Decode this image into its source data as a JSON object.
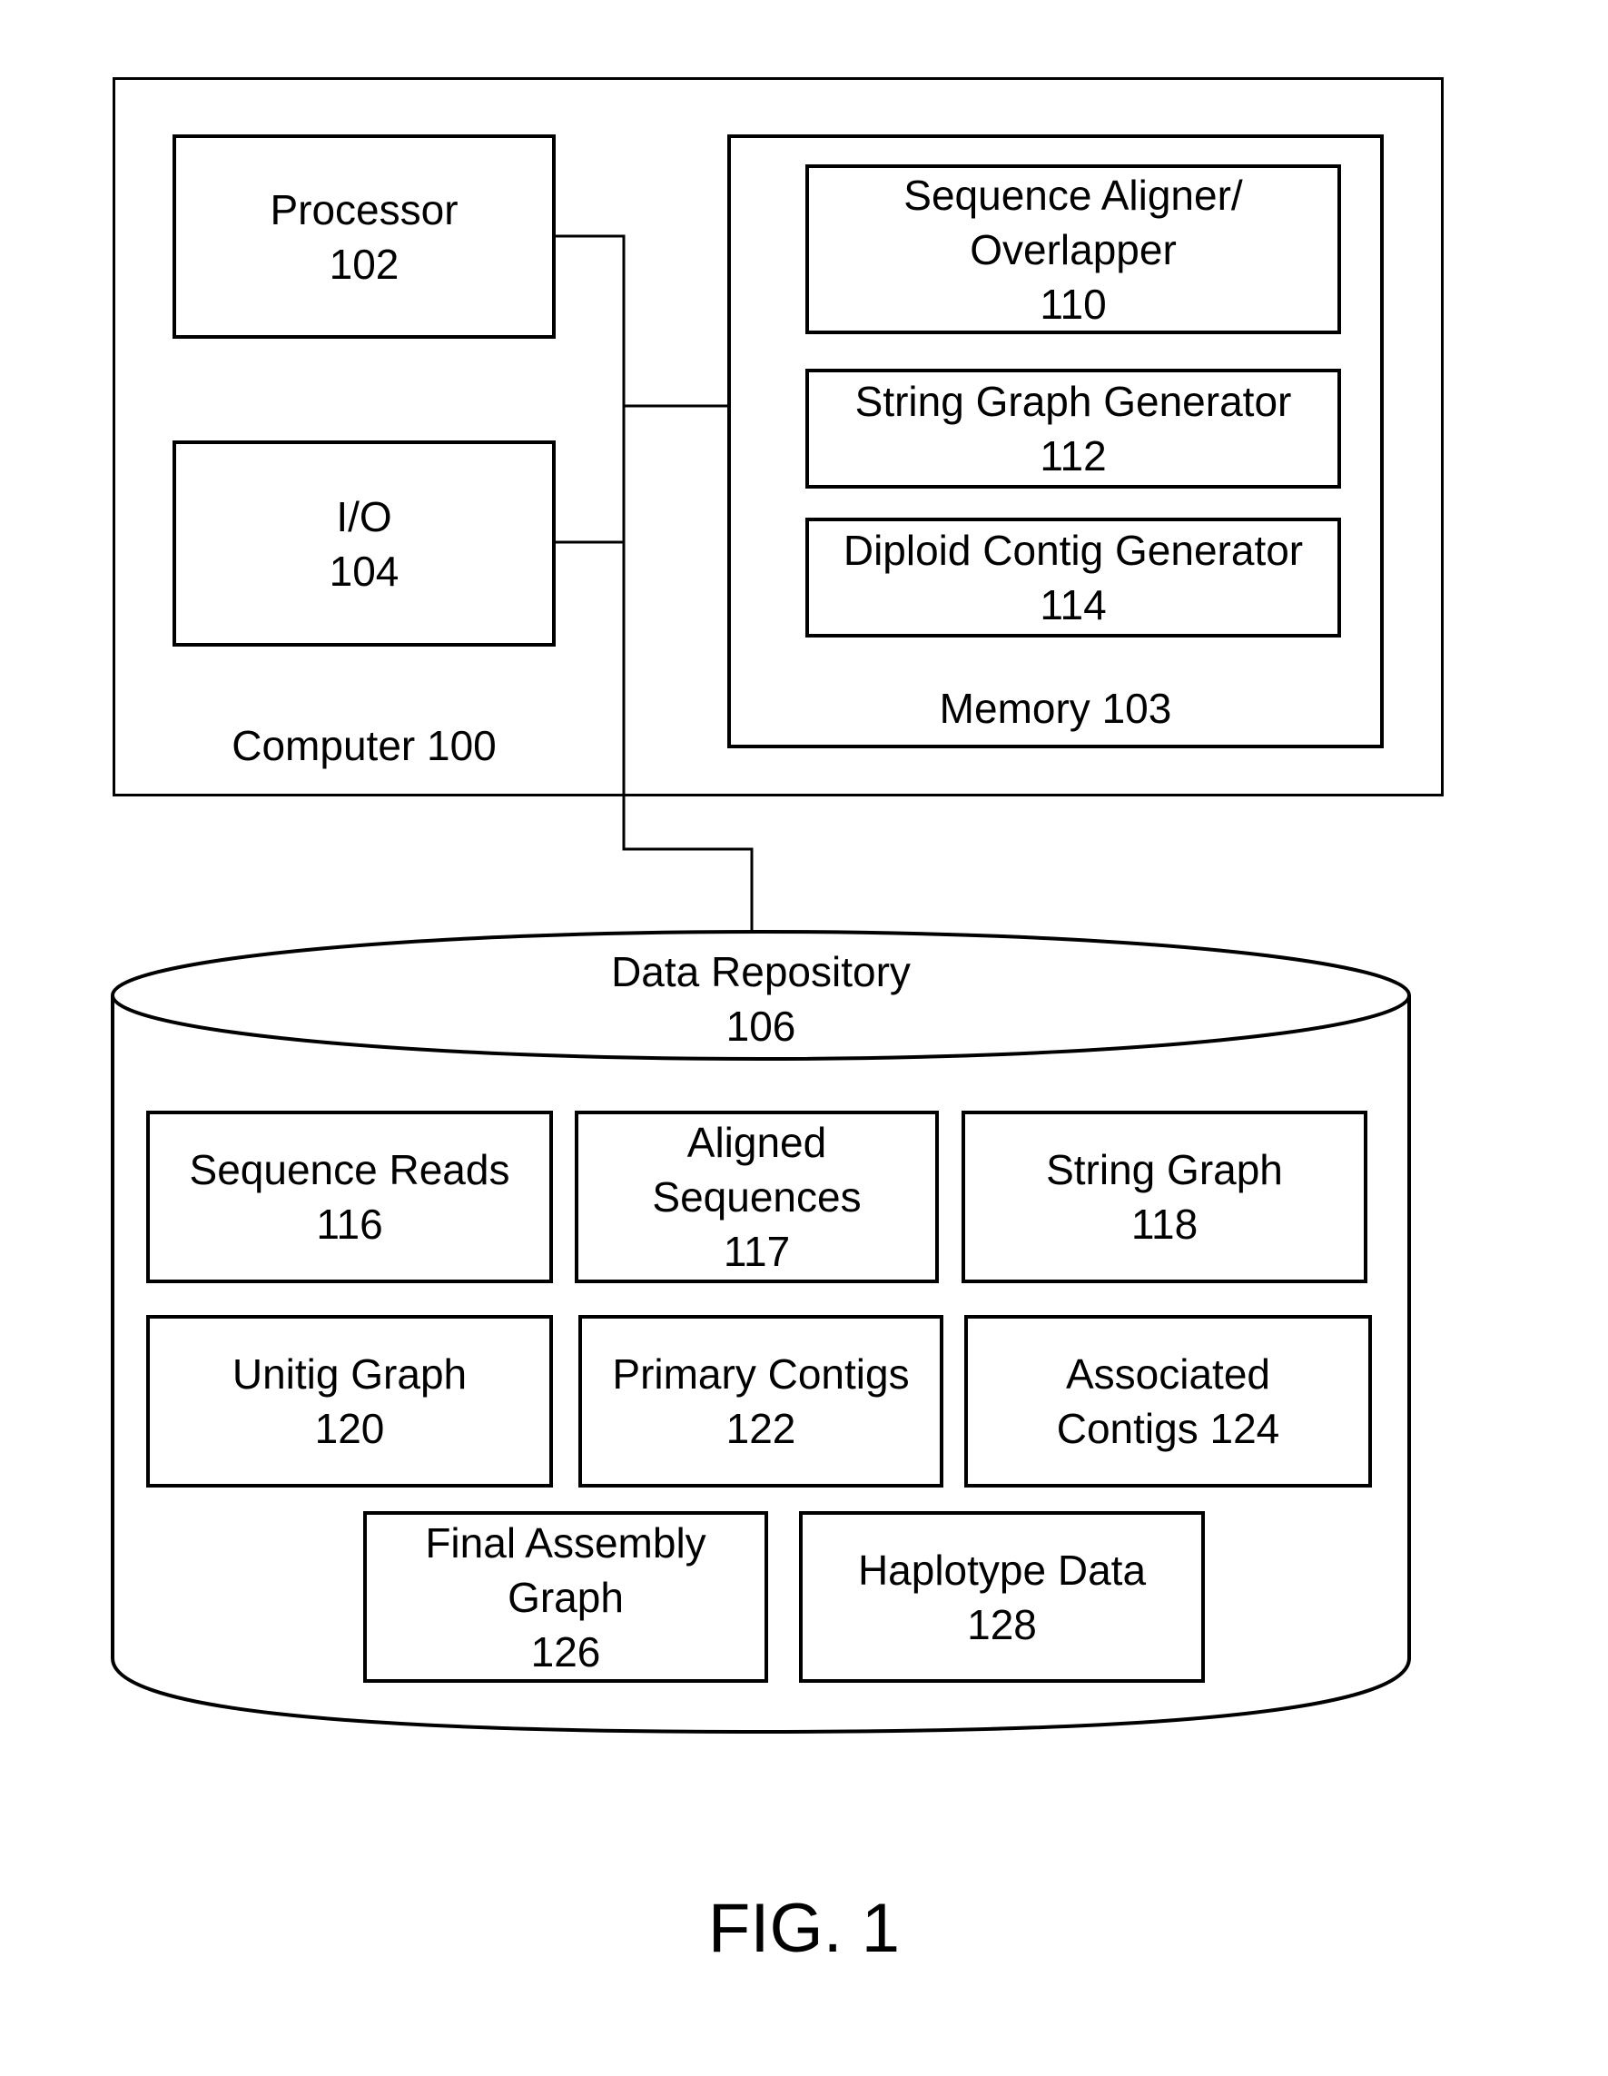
{
  "figure_label": "FIG. 1",
  "computer": {
    "label": "Computer 100",
    "processor": {
      "name": "Processor",
      "ref": "102"
    },
    "io": {
      "name": "I/O",
      "ref": "104"
    },
    "memory": {
      "label": "Memory 103",
      "modules": [
        {
          "line1": "Sequence Aligner/",
          "line2": "Overlapper",
          "ref": "110"
        },
        {
          "line1": "String Graph Generator",
          "ref": "112"
        },
        {
          "line1": "Diploid Contig Generator",
          "ref": "114"
        }
      ]
    }
  },
  "repository": {
    "name": "Data Repository",
    "ref": "106",
    "items": [
      {
        "line1": "Sequence Reads",
        "line2": "116"
      },
      {
        "line1": "Aligned",
        "line2": "Sequences",
        "line3": "117"
      },
      {
        "line1": "String Graph",
        "line2": "118"
      },
      {
        "line1": "Unitig Graph",
        "line2": "120"
      },
      {
        "line1": "Primary Contigs",
        "line2": "122"
      },
      {
        "line1": "Associated",
        "line2": "Contigs 124"
      },
      {
        "line1": "Final Assembly",
        "line2": "Graph",
        "line3": "126"
      },
      {
        "line1": "Haplotype Data",
        "line2": "128"
      }
    ]
  }
}
